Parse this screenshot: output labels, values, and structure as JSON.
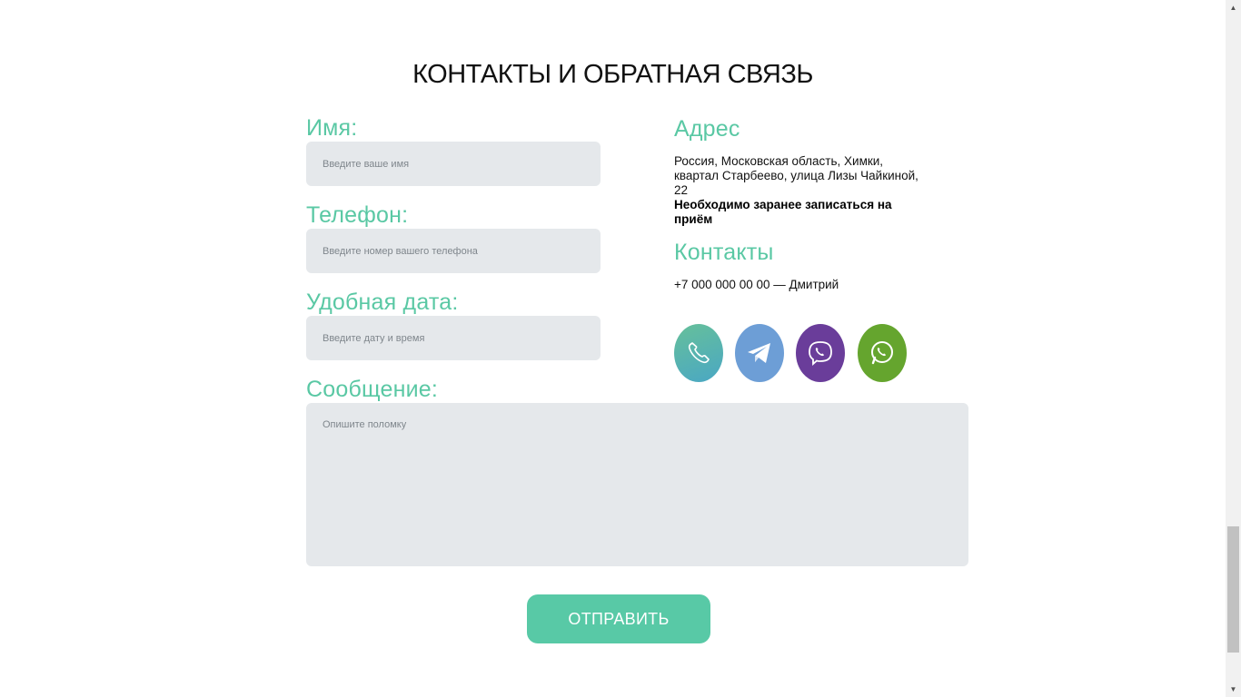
{
  "section": {
    "title": "КОНТАКТЫ И ОБРАТНАЯ СВЯЗЬ"
  },
  "form": {
    "name_label": "Имя:",
    "name_placeholder": "Введите ваше имя",
    "phone_label": "Телефон:",
    "phone_placeholder": "Введите номер вашего телефона",
    "date_label": "Удобная дата:",
    "date_placeholder": "Введите дату и время",
    "message_label": "Сообщение:",
    "message_placeholder": "Опишите поломку",
    "submit_label": "ОТПРАВИТЬ"
  },
  "address": {
    "title": "Адрес",
    "text": "Россия, Московская область, Химки, квартал Старбеево, улица Лизы Чайкиной, 22",
    "note": "Необходимо заранее записаться на приём"
  },
  "contacts": {
    "title": "Контакты",
    "phone_line": "+7 000 000 00 00 — Дмитрий"
  },
  "social": [
    {
      "icon": "phone-icon",
      "color": "#5bb7ad"
    },
    {
      "icon": "telegram-icon",
      "color": "#6d9ed6"
    },
    {
      "icon": "viber-icon",
      "color": "#6a3d9a"
    },
    {
      "icon": "whatsapp-icon",
      "color": "#65a52e"
    }
  ],
  "colors": {
    "accent": "#5ac8a4",
    "button": "#58c9a6",
    "field_bg": "#e5e8eb",
    "heading": "#111111"
  }
}
